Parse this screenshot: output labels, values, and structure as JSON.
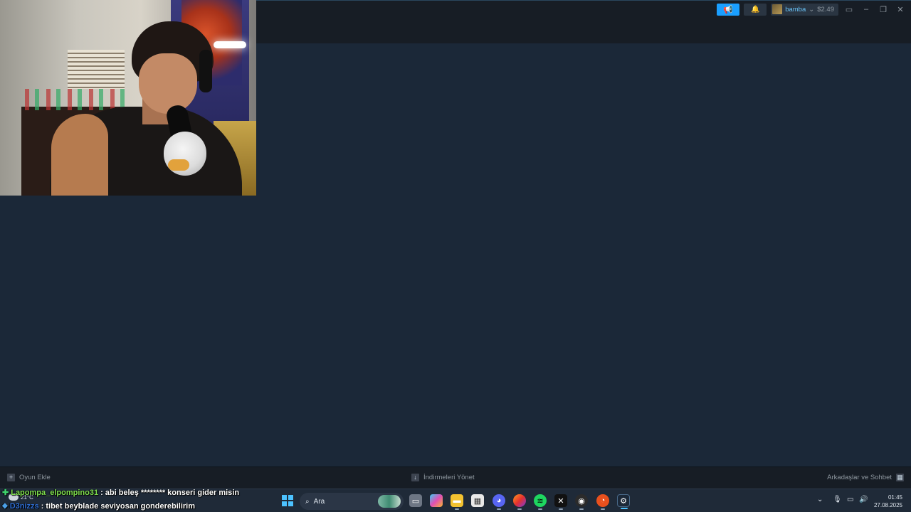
{
  "steam": {
    "user": {
      "name": "bamba",
      "caret": "⌄",
      "wallet": "$2.49"
    },
    "bottom_bar": {
      "add_game": "Oyun Ekle",
      "manage_downloads": "İndirmeleri Yönet",
      "friends_chat": "Arkadaşlar ve Sohbet"
    }
  },
  "chat": [
    {
      "user": "Lapompa_elpompino31",
      "separator": ":",
      "message": "abi beleş ******** konseri gider misin"
    },
    {
      "user": "D3nizzs",
      "separator": ":",
      "message": "tibet beyblade seviyosan gonderebilirim"
    }
  ],
  "taskbar": {
    "weather": "21°C",
    "search_placeholder": "Ara",
    "clock": {
      "time": "01:45",
      "date": "27.08.2025"
    }
  },
  "colors": {
    "steam_bg": "#1b2838",
    "steam_top": "#171d25",
    "accent_blue": "#1a9fff",
    "username_blue": "#67c1f5",
    "chat_user1": "#7fe04e",
    "chat_user2": "#2f6fd6"
  }
}
